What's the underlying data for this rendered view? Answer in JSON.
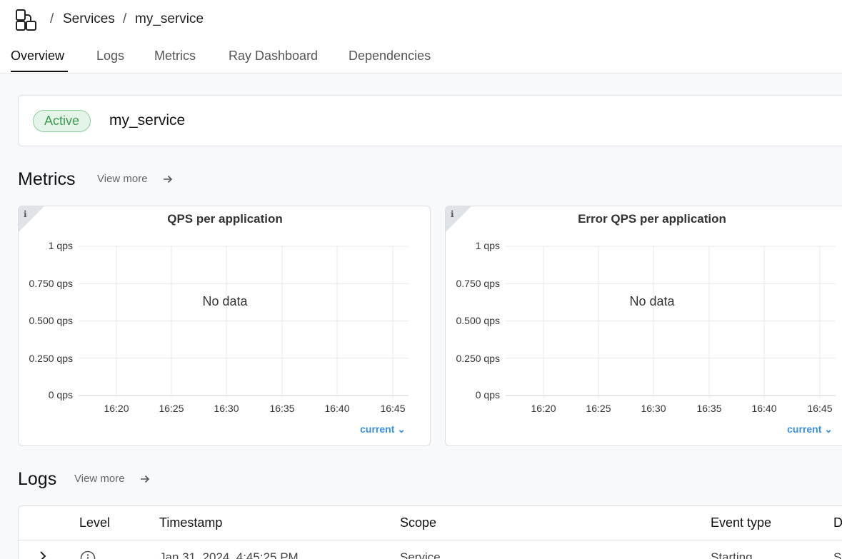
{
  "breadcrumb": {
    "separator": "/",
    "items": [
      "Services",
      "my_service"
    ]
  },
  "tabs": [
    "Overview",
    "Logs",
    "Metrics",
    "Ray Dashboard",
    "Dependencies"
  ],
  "active_tab": "Overview",
  "service": {
    "status": "Active",
    "name": "my_service"
  },
  "metrics_section": {
    "title": "Metrics",
    "view_more": "View more"
  },
  "logs_section": {
    "title": "Logs",
    "view_more": "View more"
  },
  "colors": {
    "accent": "#3a8fd8",
    "active_badge_bg": "#e5f4e8",
    "active_badge_text": "#3d9a50"
  },
  "chart_data": [
    {
      "type": "line",
      "title": "QPS per application",
      "x": [
        "16:20",
        "16:25",
        "16:30",
        "16:35",
        "16:40",
        "16:45"
      ],
      "y_ticks": [
        "1 qps",
        "0.750 qps",
        "0.500 qps",
        "0.250 qps",
        "0 qps"
      ],
      "ylim": [
        0,
        1
      ],
      "series": [],
      "empty_message": "No data",
      "time_selector": "current",
      "grid": true
    },
    {
      "type": "line",
      "title": "Error QPS per application",
      "x": [
        "16:20",
        "16:25",
        "16:30",
        "16:35",
        "16:40",
        "16:45"
      ],
      "y_ticks": [
        "1 qps",
        "0.750 qps",
        "0.500 qps",
        "0.250 qps",
        "0 qps"
      ],
      "ylim": [
        0,
        1
      ],
      "series": [],
      "empty_message": "No data",
      "time_selector": "current",
      "grid": true
    }
  ],
  "logs_table": {
    "columns": [
      "Level",
      "Timestamp",
      "Scope",
      "Event type",
      "D"
    ],
    "rows": [
      {
        "timestamp": "Jan 31, 2024, 4:45:25 PM",
        "scope": "Service",
        "event_type": "Starting",
        "d": "S"
      }
    ]
  }
}
